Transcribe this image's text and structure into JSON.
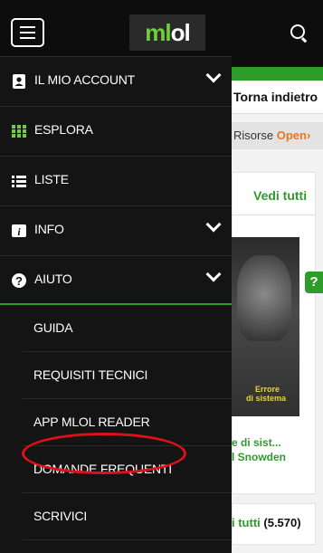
{
  "header": {
    "logo_green": "ml",
    "logo_white": "ol"
  },
  "background_page": {
    "back_label": "Torna indietro",
    "resources_label": "Risorse",
    "resources_open": "Open",
    "view_all": "Vedi tutti",
    "book": {
      "cover_title_1": "Errore",
      "cover_title_2": "di sistema",
      "title": "e di sist...",
      "author": "l Snowden"
    },
    "view_all_count_label": "i tutti",
    "view_all_count": "(5.570)"
  },
  "drawer": {
    "items": [
      {
        "label": "IL MIO ACCOUNT",
        "icon": "user-icon",
        "expandable": true
      },
      {
        "label": "ESPLORA",
        "icon": "grid-icon",
        "expandable": false
      },
      {
        "label": "LISTE",
        "icon": "list-icon",
        "expandable": false
      },
      {
        "label": "INFO",
        "icon": "info-icon",
        "expandable": true
      },
      {
        "label": "AIUTO",
        "icon": "help-icon",
        "expandable": true
      }
    ],
    "help_subitems": [
      {
        "label": "GUIDA"
      },
      {
        "label": "REQUISITI TECNICI"
      },
      {
        "label": "APP MLOL READER"
      },
      {
        "label": "DOMANDE FREQUENTI"
      },
      {
        "label": "SCRIVICI"
      }
    ]
  },
  "colors": {
    "accent": "#2d9c2a",
    "highlight": "#e0101a",
    "drawer_bg": "#141414",
    "topbar_bg": "#0d0d0d",
    "open_badge": "#e87722"
  }
}
